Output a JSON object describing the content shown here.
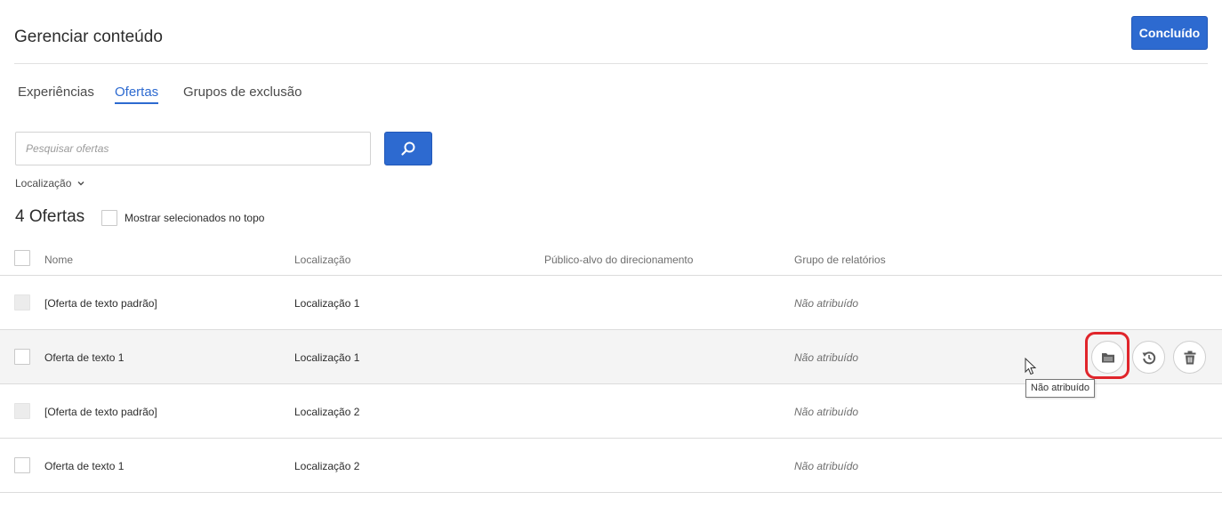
{
  "header": {
    "title": "Gerenciar conteúdo",
    "done_label": "Concluído"
  },
  "tabs": [
    {
      "label": "Experiências",
      "active": false
    },
    {
      "label": "Ofertas",
      "active": true
    },
    {
      "label": "Grupos de exclusão",
      "active": false
    }
  ],
  "search": {
    "placeholder": "Pesquisar ofertas",
    "value": "",
    "button_icon": "search-icon"
  },
  "filter": {
    "label": "Localização",
    "icon": "chevron-down-icon"
  },
  "summary": {
    "count_label": "4 Ofertas",
    "show_selected_label": "Mostrar selecionados no topo",
    "show_selected_checked": false
  },
  "table": {
    "columns": [
      "Nome",
      "Localização",
      "Público-alvo do direcionamento",
      "Grupo de relatórios"
    ],
    "rows": [
      {
        "name": "[Oferta de texto padrão]",
        "location": "Localização 1",
        "audience": "",
        "group": "Não atribuído",
        "checkbox_disabled": true
      },
      {
        "name": "Oferta de texto 1",
        "location": "Localização 1",
        "audience": "",
        "group": "Não atribuído",
        "checkbox_disabled": false,
        "hovered": true
      },
      {
        "name": "[Oferta de texto padrão]",
        "location": "Localização 2",
        "audience": "",
        "group": "Não atribuído",
        "checkbox_disabled": true
      },
      {
        "name": "Oferta de texto 1",
        "location": "Localização 2",
        "audience": "",
        "group": "Não atribuído",
        "checkbox_disabled": false
      }
    ]
  },
  "row_actions": [
    {
      "icon": "folder-icon",
      "highlighted": true
    },
    {
      "icon": "reset-icon",
      "highlighted": false
    },
    {
      "icon": "trash-icon",
      "highlighted": false
    }
  ],
  "tooltip": {
    "text": "Não atribuído"
  },
  "colors": {
    "accent": "#2d6ad0",
    "highlight": "#e0252b",
    "row_hover": "#f4f4f4"
  }
}
